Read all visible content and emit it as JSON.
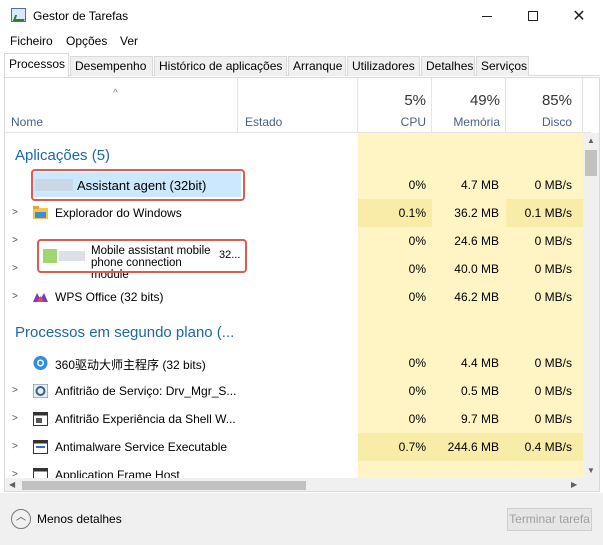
{
  "window": {
    "title": "Gestor de Tarefas",
    "minimize_icon": "minimize-icon",
    "maximize_icon": "maximize-icon",
    "close_icon": "close-icon"
  },
  "menu": [
    "Ficheiro",
    "Opções",
    "Ver"
  ],
  "tabs": [
    "Processos",
    "Desempenho",
    "Histórico de aplicações",
    "Arranque",
    "Utilizadores",
    "Detalhes",
    "Serviços"
  ],
  "header": {
    "name": "Nome",
    "status": "Estado",
    "cpu_pct": "5%",
    "cpu": "CPU",
    "mem_pct": "49%",
    "mem": "Memória",
    "disk_pct": "85%",
    "disk": "Disco"
  },
  "groups": {
    "apps": "Aplicações (5)",
    "background": "Processos em segundo plano (..."
  },
  "rows": [
    {
      "name": "Assistant agent (32bit)",
      "cpu": "0%",
      "mem": "4.7 MB",
      "disk": "0 MB/s"
    },
    {
      "name": "Explorador do Windows",
      "cpu": "0.1%",
      "mem": "36.2 MB",
      "disk": "0.1 MB/s"
    },
    {
      "name": "Mobile assistant mobile phone connection module",
      "suffix": "32...",
      "cpu": "0%",
      "mem": "24.6 MB",
      "disk": "0 MB/s"
    },
    {
      "name": "",
      "cpu": "0%",
      "mem": "40.0 MB",
      "disk": "0 MB/s"
    },
    {
      "name": "WPS Office (32 bits)",
      "cpu": "0%",
      "mem": "46.2 MB",
      "disk": "0 MB/s"
    },
    {
      "name": "360驱动大师主程序 (32 bits)",
      "cpu": "0%",
      "mem": "4.4 MB",
      "disk": "0 MB/s"
    },
    {
      "name": "Anfitrião de Serviço: Drv_Mgr_S...",
      "cpu": "0%",
      "mem": "0.5 MB",
      "disk": "0 MB/s"
    },
    {
      "name": "Anfitrião Experiência da Shell W...",
      "cpu": "0%",
      "mem": "9.7 MB",
      "disk": "0 MB/s"
    },
    {
      "name": "Antimalware Service Executable",
      "cpu": "0.7%",
      "mem": "244.6 MB",
      "disk": "0.4 MB/s"
    },
    {
      "name": "Application Frame Host",
      "cpu": "",
      "mem": "",
      "disk": ""
    }
  ],
  "footer": {
    "less_details": "Menos detalhes",
    "end_task": "Terminar tarefa"
  },
  "colors": {
    "resource_bg": "#fff4c4",
    "resource_bg_strong": "#f9eca8",
    "group_text": "#1a67b4",
    "selected": "#cce8ff",
    "highlight_box": "#e05a4e"
  }
}
